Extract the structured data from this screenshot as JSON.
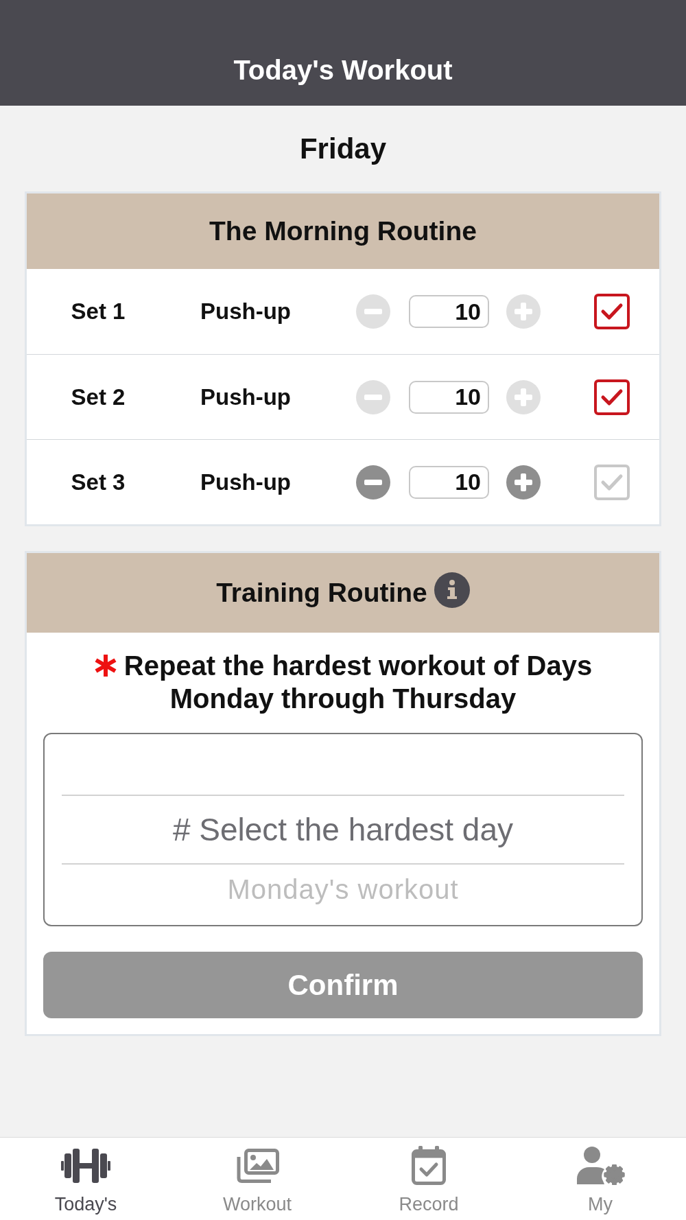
{
  "header": {
    "title": "Today's Workout"
  },
  "day": "Friday",
  "morning_routine": {
    "title": "The Morning Routine",
    "sets": [
      {
        "label": "Set 1",
        "exercise": "Push-up",
        "reps": "10",
        "stepper_disabled": true,
        "checked": true
      },
      {
        "label": "Set 2",
        "exercise": "Push-up",
        "reps": "10",
        "stepper_disabled": true,
        "checked": true
      },
      {
        "label": "Set 3",
        "exercise": "Push-up",
        "reps": "10",
        "stepper_disabled": false,
        "checked": false
      }
    ]
  },
  "training_routine": {
    "title": "Training Routine",
    "required": true,
    "instruction": "Repeat the hardest workout of Days Monday through Thursday",
    "picker": {
      "options": [
        {
          "label": "# Select the hardest day",
          "selected": true
        },
        {
          "label": "Monday's workout",
          "selected": false
        }
      ]
    },
    "confirm_button": {
      "label": "Confirm",
      "disabled": true
    }
  },
  "tab_bar": {
    "tabs": [
      {
        "label": "Today's",
        "selected": true
      },
      {
        "label": "Workout",
        "selected": false
      },
      {
        "label": "Record",
        "selected": false
      },
      {
        "label": "My",
        "selected": false
      }
    ]
  }
}
